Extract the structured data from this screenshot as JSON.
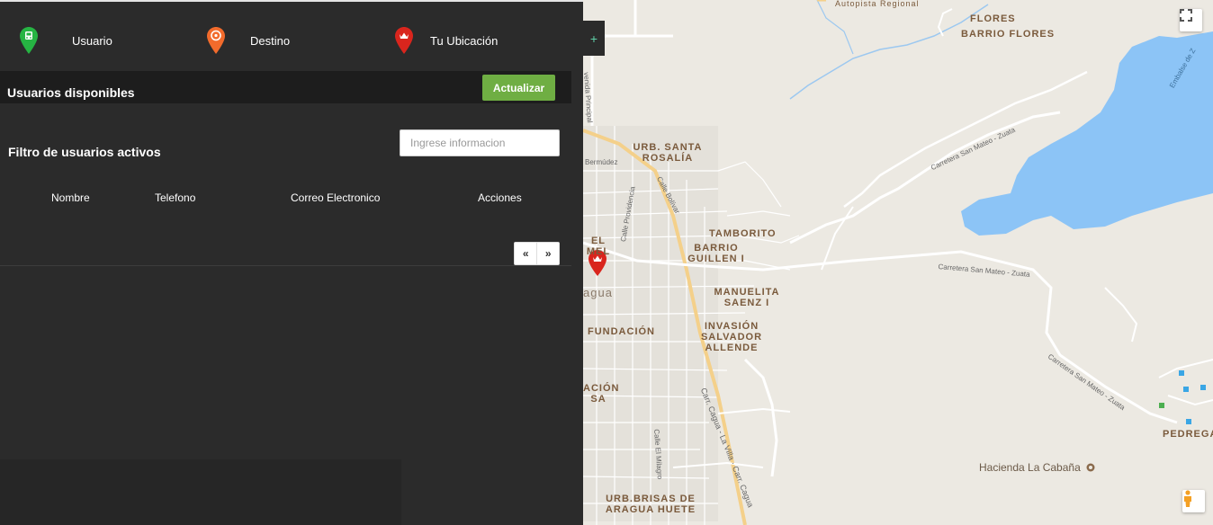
{
  "legend": {
    "usuario": "Usuario",
    "destino": "Destino",
    "ubicacion": "Tu Ubicación"
  },
  "header": {
    "title": "Usuarios disponibles",
    "update_label": "Actualizar"
  },
  "filter": {
    "title": "Filtro de usuarios activos",
    "placeholder": "Ingrese informacion"
  },
  "table": {
    "columns": [
      "Nombre",
      "Telefono",
      "Correo Electronico",
      "Acciones"
    ]
  },
  "pager": {
    "prev": "«",
    "next": "»"
  },
  "toggle": {
    "label": "+"
  },
  "map": {
    "labels": {
      "autopista": "Autopista Regional",
      "flores": "FLORES",
      "barrio_flores": "BARRIO FLORES",
      "urb_santa_rosalia": "URB. SANTA ROSALÍA",
      "tamborito": "TAMBORITO",
      "barrio_guillen": "BARRIO GUILLEN I",
      "manuelita": "MANUELITA SAENZ I",
      "invasion": "INVASIÓN SALVADOR ALLENDE",
      "fundacion": "FUNDACIÓN",
      "agua": "agua",
      "el_mel": "EL MEL",
      "acion_sa": "ACIÓN SA",
      "pedrega": "PEDREGA",
      "urb_brisas": "URB.BRISAS DE ARAGUA HUETE",
      "hacienda": "Hacienda La Cabaña",
      "embalse": "Embalse de Z",
      "carretera1": "Carretera San Mateo - Zuata",
      "carretera2": "Carretera San Mateo - Zuata",
      "carretera3": "Carretera San Mateo - Zuata",
      "car_cagua": "Carr. Cagua - La Villa · Carr. Cagua",
      "calle_providencia": "Calle Providencia",
      "calle_bolivar": "Calle Bolívar",
      "calle_milagro": "Calle El Milagro",
      "avenida_principal": "venida Principal",
      "bermudez": "Bermúdez"
    }
  },
  "colors": {
    "panel": "#2b2b2b",
    "accent_green": "#6fae43",
    "water": "#8cc4f6",
    "marker_red": "#d9251d",
    "marker_orange": "#f26b2c",
    "marker_green": "#26b443"
  }
}
